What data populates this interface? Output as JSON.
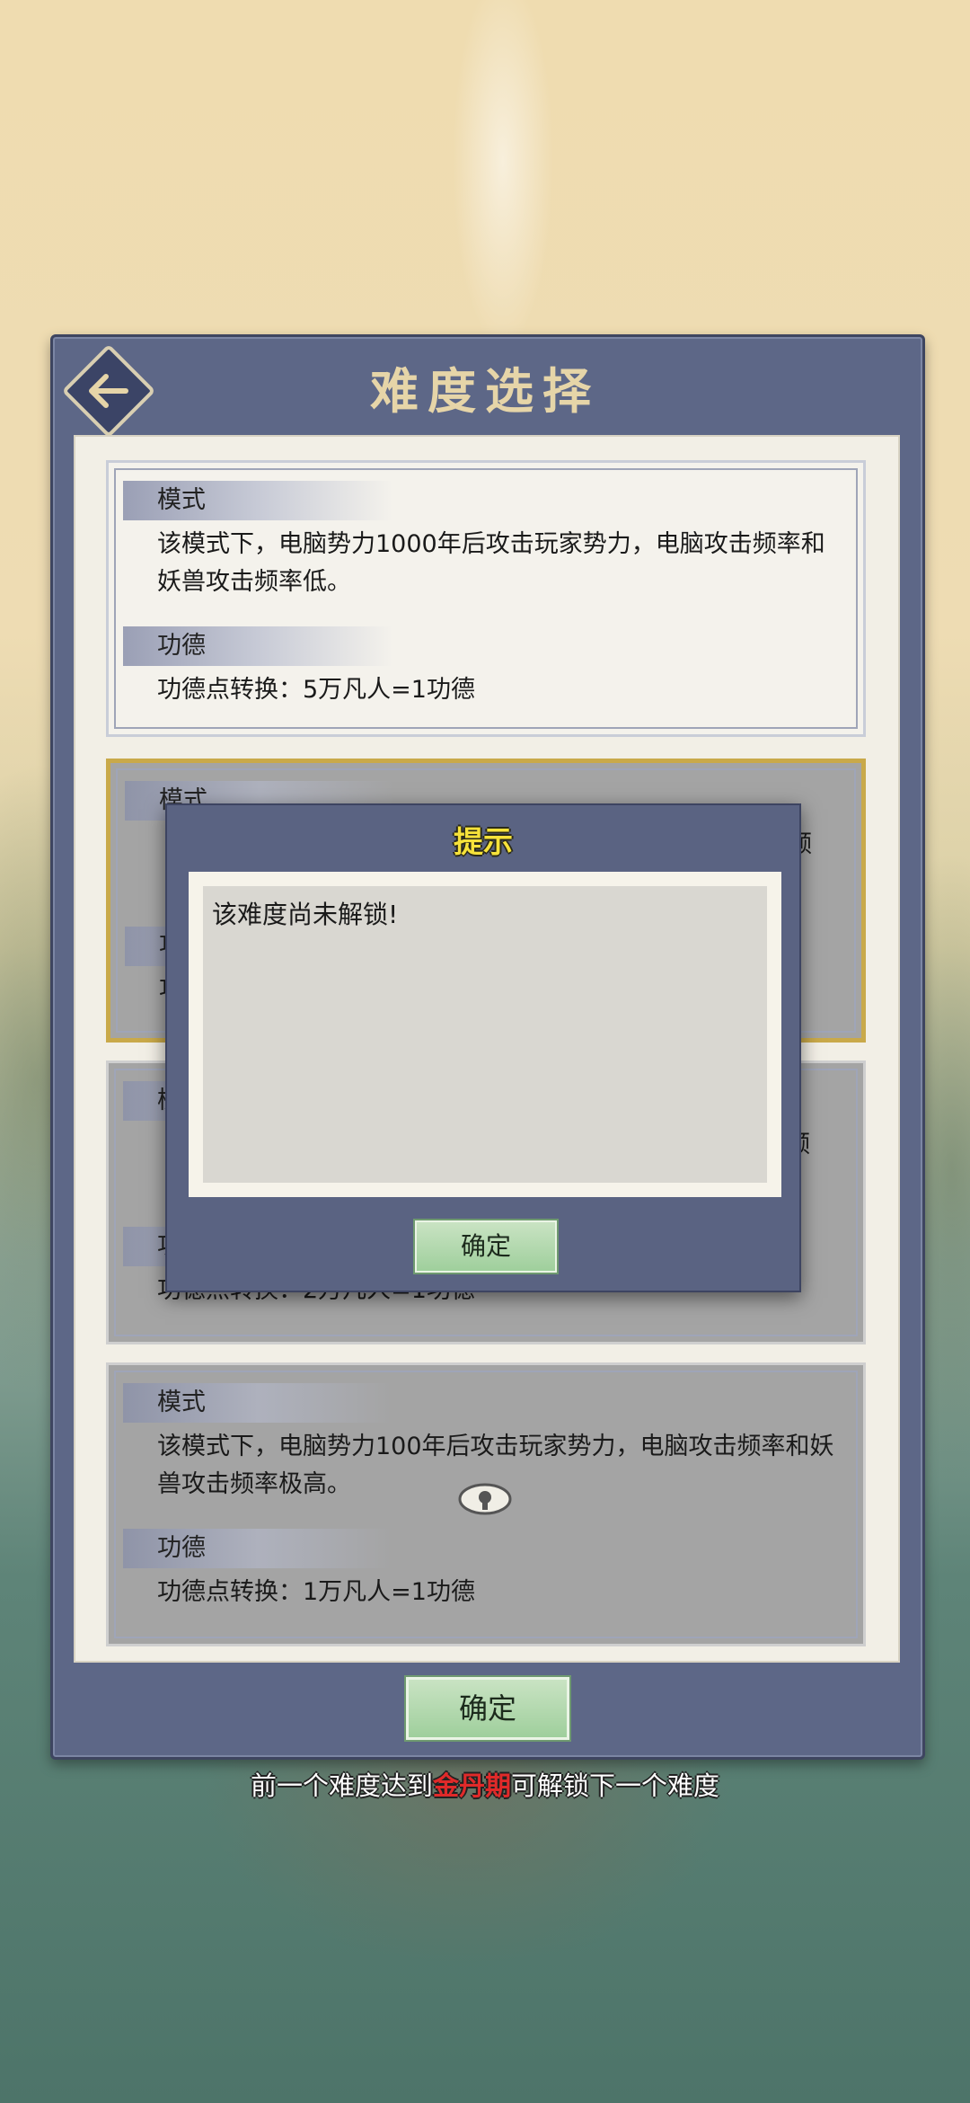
{
  "header": {
    "title": "难度选择"
  },
  "cards": [
    {
      "mode_label": "模式",
      "mode_text": "该模式下，电脑势力1000年后攻击玩家势力，电脑攻击频率和妖兽攻击频率低。",
      "merit_label": "功德",
      "merit_text": "功德点转换：5万凡人=1功德",
      "state": "unlocked"
    },
    {
      "mode_label": "模式",
      "merit_label": "功",
      "merit_text_partial": "功",
      "side_char": "频",
      "state": "locked-selected"
    },
    {
      "mode_label": "模",
      "merit_label": "功",
      "merit_text": "功德点转换：2万凡人=1功德",
      "side_char": "频",
      "state": "locked"
    },
    {
      "mode_label": "模式",
      "mode_text": "该模式下，电脑势力100年后攻击玩家势力，电脑攻击频率和妖兽攻击频率极高。",
      "merit_label": "功德",
      "merit_text": "功德点转换：1万凡人=1功德",
      "state": "locked"
    }
  ],
  "confirm_label": "确定",
  "hint": {
    "prefix": "前一个难度达到",
    "highlight": "金丹期",
    "suffix": "可解锁下一个难度"
  },
  "dialog": {
    "title": "提示",
    "message": "该难度尚未解锁!",
    "ok_label": "确定"
  },
  "colors": {
    "panel": "#5d6787",
    "highlight": "#e02a2a",
    "dialog_title": "#f6e23a",
    "button": "#9fcf9c"
  }
}
